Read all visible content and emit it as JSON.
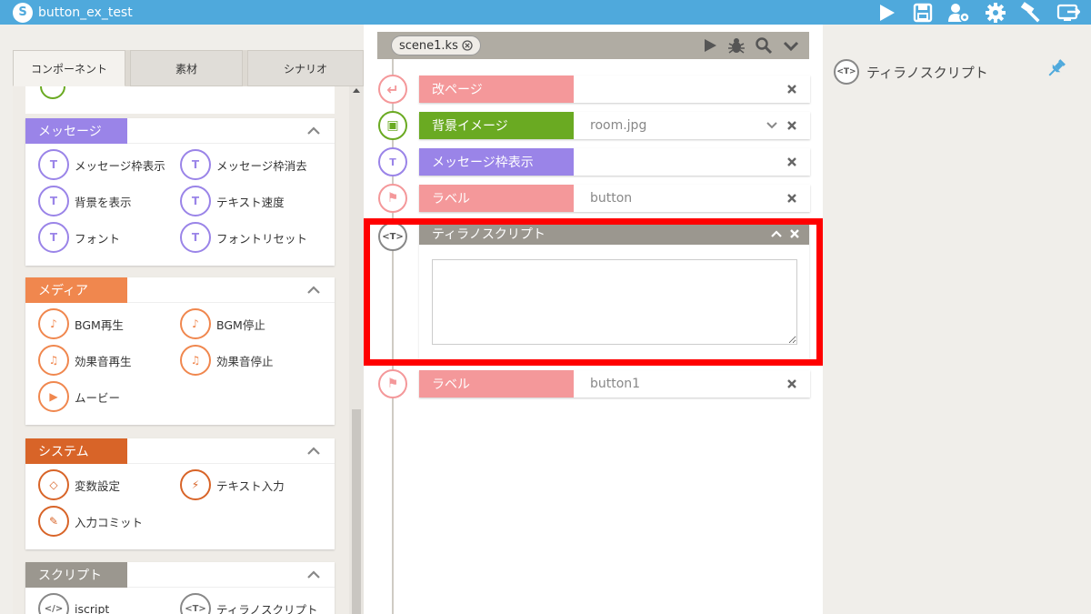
{
  "app": {
    "title": "button_ex_test",
    "logo_glyph": "S"
  },
  "toolbar": {
    "icons": [
      "play-icon",
      "save-icon",
      "users-gear-icon",
      "gear-icon",
      "hammer-icon",
      "export-icon"
    ]
  },
  "left": {
    "tabs": [
      "コンポーネント",
      "素材",
      "シナリオ"
    ],
    "sections": [
      {
        "title": "メッセージ",
        "color": "#9a84e8",
        "items": [
          {
            "label": "メッセージ枠表示",
            "glyph": "T"
          },
          {
            "label": "メッセージ枠消去",
            "glyph": "T"
          },
          {
            "label": "背景を表示",
            "glyph": "T"
          },
          {
            "label": "テキスト速度",
            "glyph": "T"
          },
          {
            "label": "フォント",
            "glyph": "T"
          },
          {
            "label": "フォントリセット",
            "glyph": "T"
          }
        ]
      },
      {
        "title": "メディア",
        "color": "#f0874e",
        "items": [
          {
            "label": "BGM再生",
            "glyph": "♪"
          },
          {
            "label": "BGM停止",
            "glyph": "♪"
          },
          {
            "label": "効果音再生",
            "glyph": "♫"
          },
          {
            "label": "効果音停止",
            "glyph": "♫"
          },
          {
            "label": "ムービー",
            "glyph": "▶"
          }
        ]
      },
      {
        "title": "システム",
        "color": "#d86428",
        "items": [
          {
            "label": "変数設定",
            "glyph": "◇"
          },
          {
            "label": "テキスト入力",
            "glyph": "⚡"
          },
          {
            "label": "入力コミット",
            "glyph": "✎"
          }
        ]
      },
      {
        "title": "スクリプト",
        "color": "#9b978f",
        "items": [
          {
            "label": "iscript",
            "glyph": "</>"
          },
          {
            "label": "ティラノスクリプト",
            "glyph": "<T>"
          }
        ]
      }
    ]
  },
  "center": {
    "scene_tab": "scene1.ks",
    "commands": [
      {
        "label": "改ページ",
        "value": "",
        "color": "#f4989a",
        "glyph": "↵",
        "chev": false
      },
      {
        "label": "背景イメージ",
        "value": "room.jpg",
        "color": "#6aaa22",
        "glyph": "▣",
        "chev": true
      },
      {
        "label": "メッセージ枠表示",
        "value": "",
        "color": "#9a84e8",
        "glyph": "T",
        "chev": false
      },
      {
        "label": "ラベル",
        "value": "button",
        "color": "#f4989a",
        "glyph": "⚑",
        "chev": false
      }
    ],
    "tyrano": {
      "label": "ティラノスクリプト",
      "glyph": "<T>",
      "text": ""
    },
    "after": {
      "label": "ラベル",
      "value": "button1",
      "color": "#f4989a",
      "glyph": "⚑"
    }
  },
  "right": {
    "title": "ティラノスクリプト",
    "glyph": "<T>"
  },
  "colors": {
    "accent": "#4fa9dc",
    "highlight": "#ff0000"
  }
}
